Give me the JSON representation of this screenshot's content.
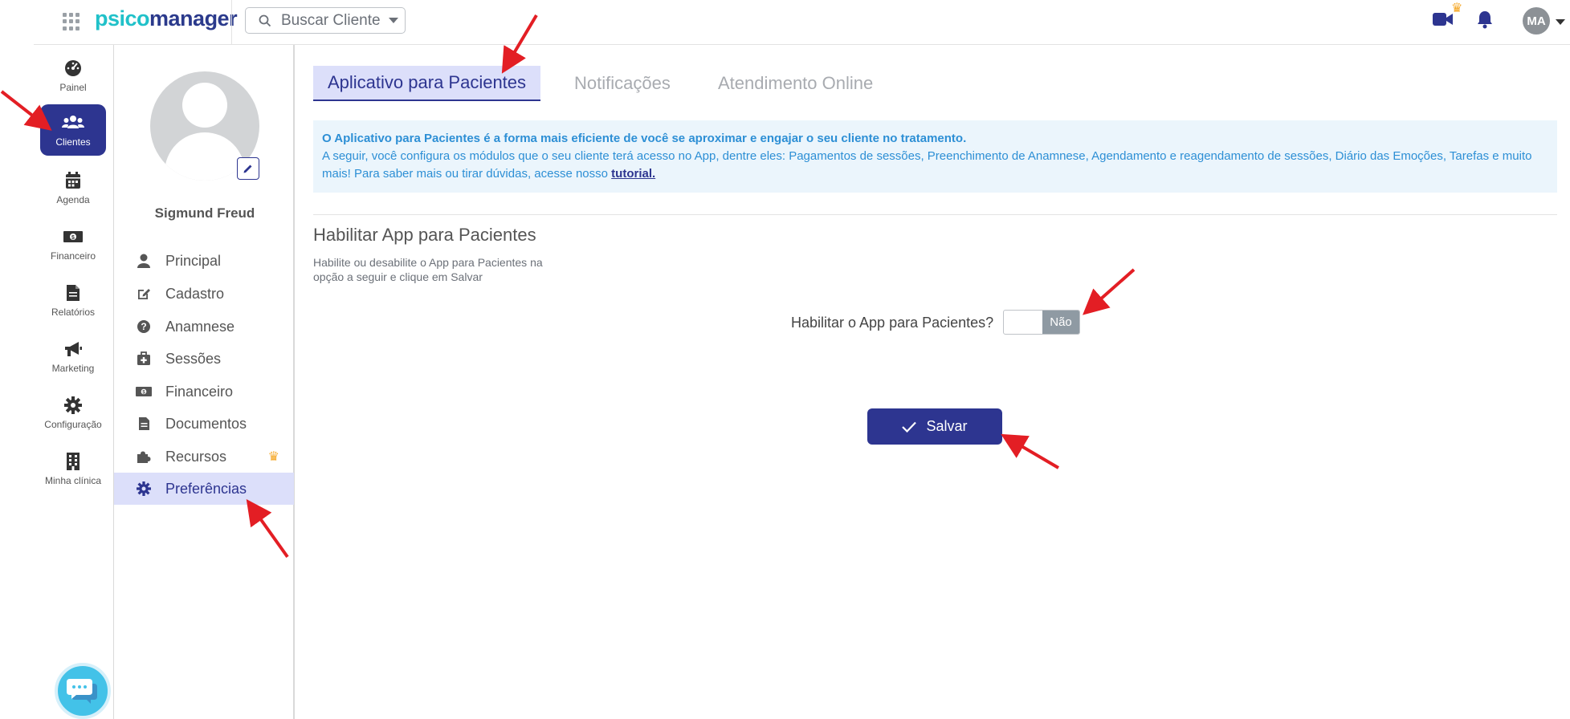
{
  "app": {
    "logo_part1": "psico",
    "logo_part2": "manager"
  },
  "header": {
    "search_label": "Buscar Cliente",
    "avatar_initials": "MA"
  },
  "leftnav": {
    "items": [
      {
        "label": "Painel",
        "icon": "dashboard-icon"
      },
      {
        "label": "Clientes",
        "icon": "users-icon",
        "active": true
      },
      {
        "label": "Agenda",
        "icon": "calendar-icon"
      },
      {
        "label": "Financeiro",
        "icon": "money-icon"
      },
      {
        "label": "Relatórios",
        "icon": "file-icon"
      },
      {
        "label": "Marketing",
        "icon": "megaphone-icon"
      },
      {
        "label": "Configuração",
        "icon": "gear-icon"
      },
      {
        "label": "Minha clínica",
        "icon": "building-icon"
      }
    ]
  },
  "client": {
    "name": "Sigmund Freud"
  },
  "subnav": {
    "items": [
      {
        "label": "Principal",
        "icon": "user-icon"
      },
      {
        "label": "Cadastro",
        "icon": "edit-icon"
      },
      {
        "label": "Anamnese",
        "icon": "question-icon"
      },
      {
        "label": "Sessões",
        "icon": "medkit-icon"
      },
      {
        "label": "Financeiro",
        "icon": "money-icon"
      },
      {
        "label": "Documentos",
        "icon": "file-icon"
      },
      {
        "label": "Recursos",
        "icon": "puzzle-icon",
        "premium": true
      },
      {
        "label": "Preferências",
        "icon": "gear-icon",
        "active": true
      }
    ]
  },
  "tabs": [
    {
      "label": "Aplicativo para Pacientes",
      "active": true
    },
    {
      "label": "Notificações"
    },
    {
      "label": "Atendimento Online"
    }
  ],
  "info": {
    "headline": "O Aplicativo para Pacientes é a forma mais eficiente de você se aproximar e engajar o seu cliente no tratamento.",
    "body": "A seguir, você configura os módulos que o seu cliente terá acesso no App, dentre eles: Pagamentos de sessões, Preenchimento de Anamnese, Agendamento e reagendamento de sessões, Diário das Emoções, Tarefas e muito mais! Para saber mais ou tirar dúvidas, acesse nosso",
    "link": "tutorial."
  },
  "section": {
    "title": "Habilitar App para Pacientes",
    "description": "Habilite ou desabilite o App para Pacientes na opção a seguir e clique em Salvar"
  },
  "toggle": {
    "label": "Habilitar o App para Pacientes?",
    "state_label": "Não"
  },
  "save_button": {
    "label": "Salvar"
  },
  "colors": {
    "primary": "#2d3590",
    "accent": "#20c1c9",
    "info_bg": "#ebf5fc",
    "info_text": "#2d8fd5",
    "annotation_arrow": "#e31e24",
    "premium": "#f5a623"
  }
}
